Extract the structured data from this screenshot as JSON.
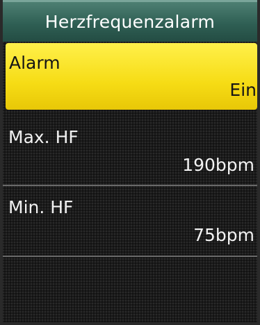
{
  "screen": {
    "title": "Herzfrequenzalarm"
  },
  "menu": {
    "items": [
      {
        "label": "Alarm",
        "value": "Ein",
        "selected": true
      },
      {
        "label": "Max. HF",
        "value": "190bpm",
        "selected": false
      },
      {
        "label": "Min. HF",
        "value": "75bpm",
        "selected": false
      }
    ]
  },
  "colors": {
    "title_bar": "#2f5f54",
    "selected_row": "#f6dc15",
    "background": "#1b1b1b",
    "text": "#f2f2f2"
  }
}
